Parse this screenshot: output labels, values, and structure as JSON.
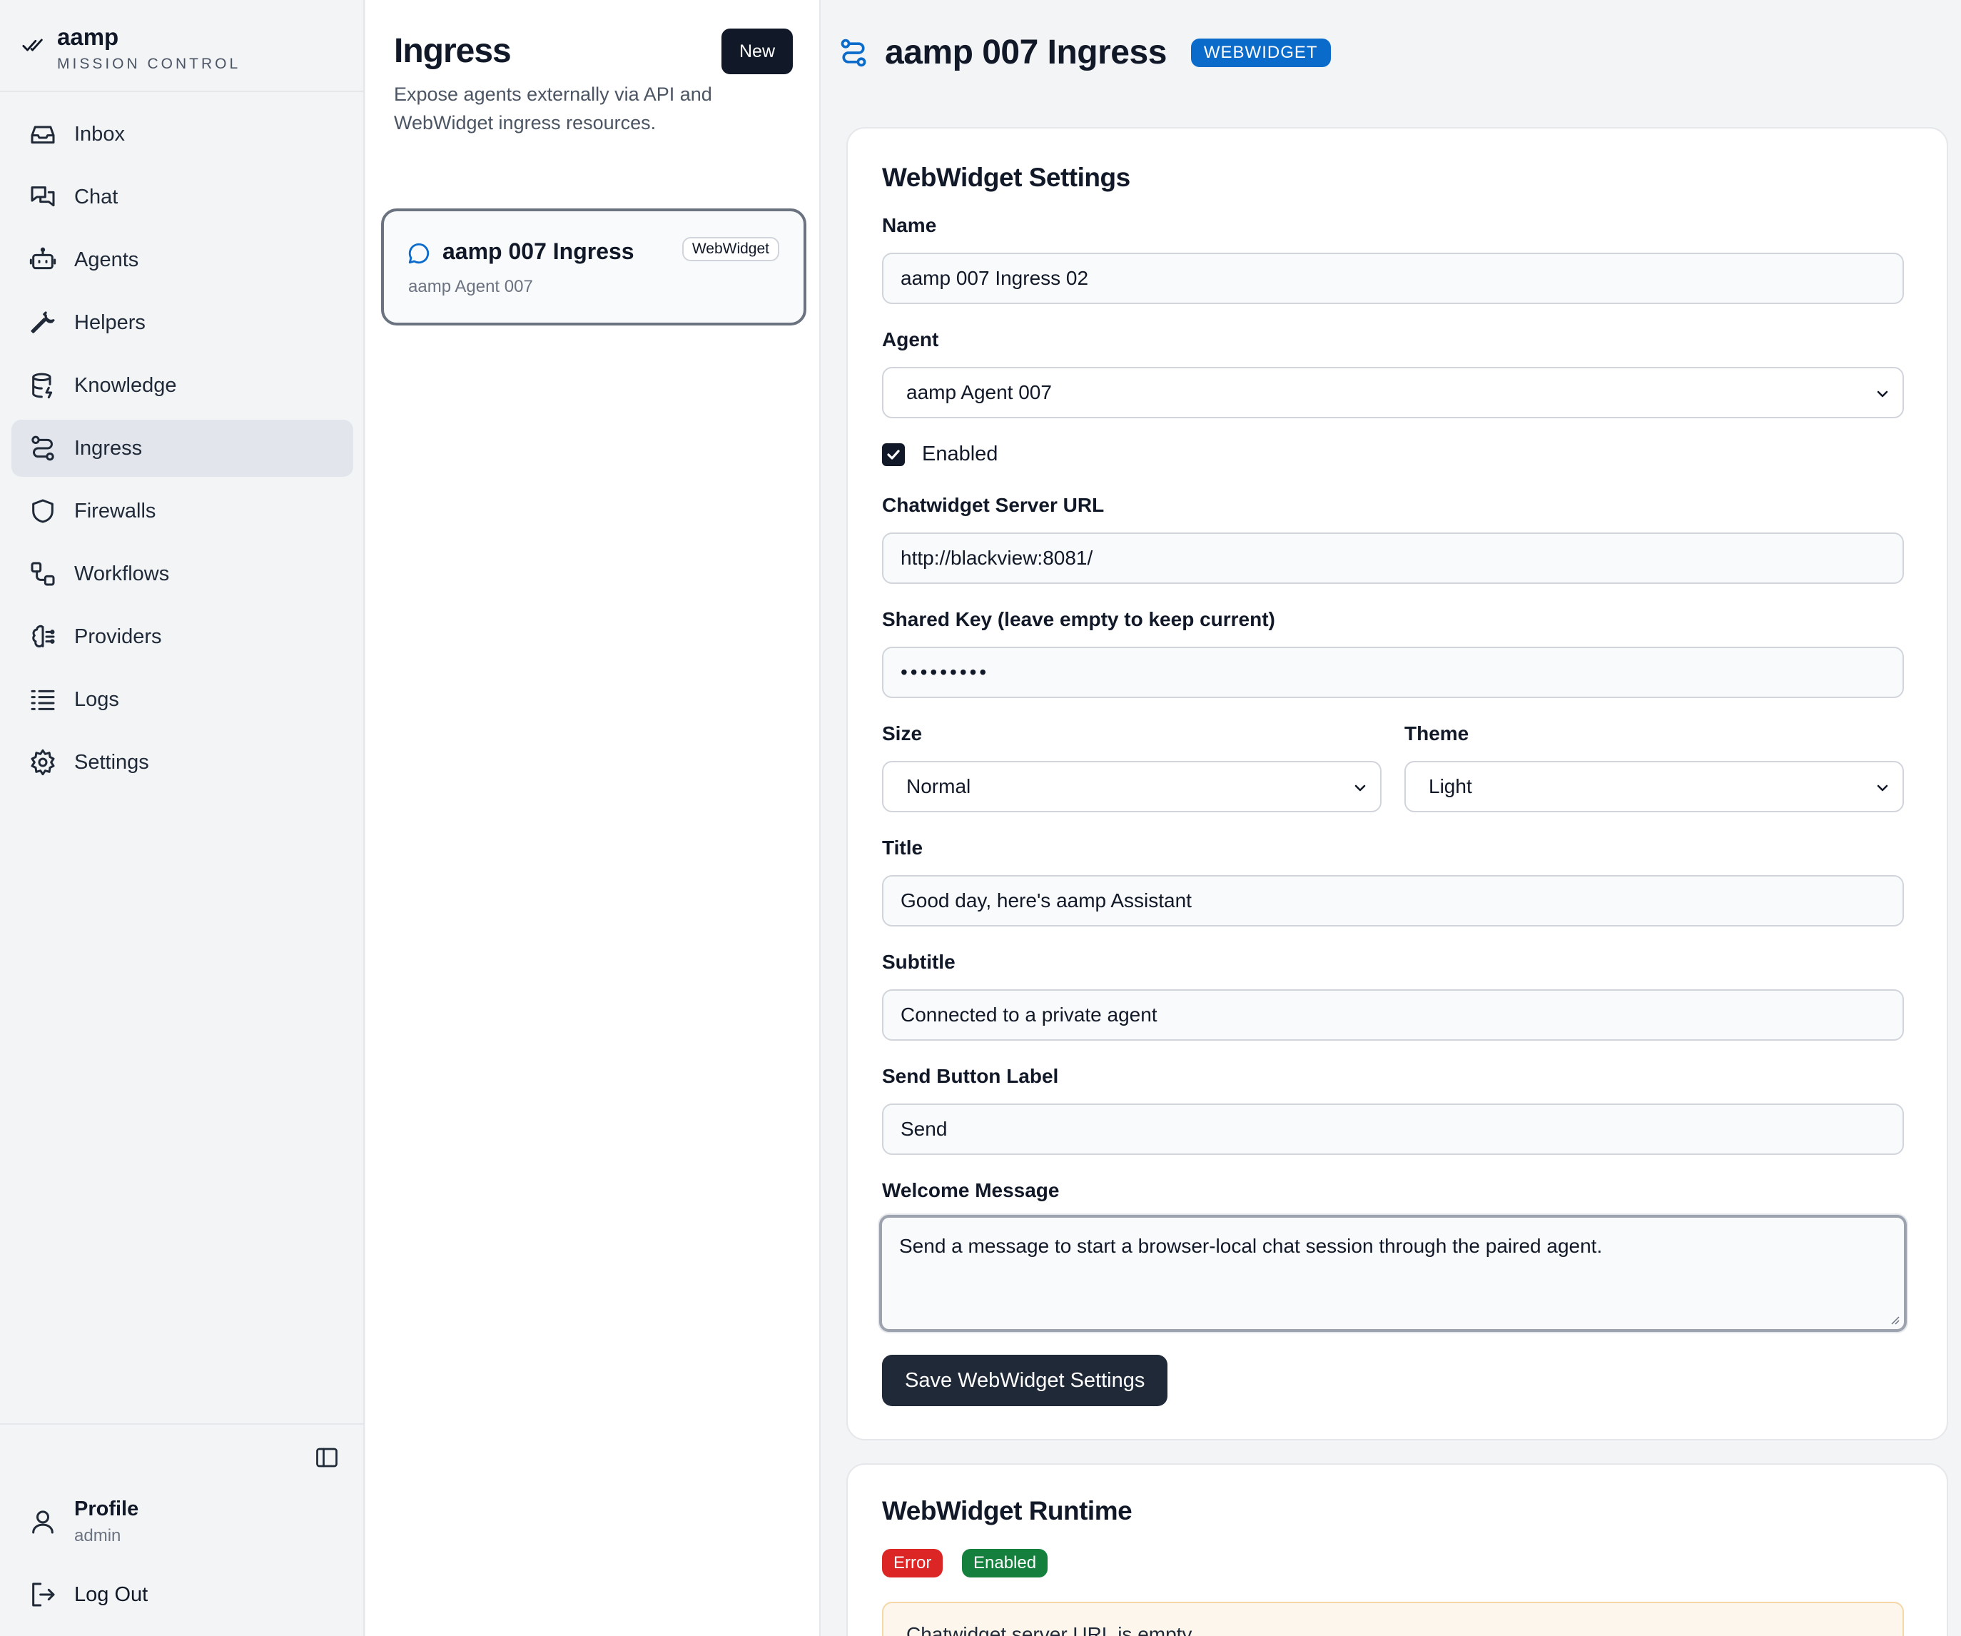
{
  "brand": {
    "name": "aamp",
    "subtitle": "MISSION CONTROL"
  },
  "sidebar": {
    "items": [
      {
        "label": "Inbox",
        "icon": "inbox-icon"
      },
      {
        "label": "Chat",
        "icon": "chat-bubbles-icon"
      },
      {
        "label": "Agents",
        "icon": "robot-icon"
      },
      {
        "label": "Helpers",
        "icon": "wrench-icon"
      },
      {
        "label": "Knowledge",
        "icon": "database-icon"
      },
      {
        "label": "Ingress",
        "icon": "route-icon",
        "active": true
      },
      {
        "label": "Firewalls",
        "icon": "shield-icon"
      },
      {
        "label": "Workflows",
        "icon": "workflow-icon"
      },
      {
        "label": "Providers",
        "icon": "brain-icon"
      },
      {
        "label": "Logs",
        "icon": "list-icon"
      },
      {
        "label": "Settings",
        "icon": "gear-icon"
      }
    ],
    "profile": {
      "name": "Profile",
      "role": "admin"
    },
    "logout_label": "Log Out"
  },
  "list": {
    "title": "Ingress",
    "new_label": "New",
    "description": "Expose agents externally via API and WebWidget ingress resources.",
    "items": [
      {
        "title": "aamp 007 Ingress",
        "badge": "WebWidget",
        "subtitle": "aamp Agent 007"
      }
    ]
  },
  "main": {
    "title": "aamp 007 Ingress",
    "type_badge": "WEBWIDGET",
    "settings": {
      "heading": "WebWidget Settings",
      "name_label": "Name",
      "name_value": "aamp 007 Ingress 02",
      "agent_label": "Agent",
      "agent_value": "aamp Agent 007",
      "enabled_label": "Enabled",
      "enabled": true,
      "server_url_label": "Chatwidget Server URL",
      "server_url_value": "http://blackview:8081/",
      "shared_key_label": "Shared Key (leave empty to keep current)",
      "shared_key_value": "•••••••••",
      "size_label": "Size",
      "size_value": "Normal",
      "theme_label": "Theme",
      "theme_value": "Light",
      "title_label": "Title",
      "title_value": "Good day, here's aamp Assistant",
      "subtitle_label": "Subtitle",
      "subtitle_value": "Connected to a private agent",
      "send_label_label": "Send Button Label",
      "send_label_value": "Send",
      "welcome_label": "Welcome Message",
      "welcome_value": "Send a message to start a browser-local chat session through the paired agent.",
      "save_label": "Save WebWidget Settings"
    },
    "runtime": {
      "heading": "WebWidget Runtime",
      "status_error": "Error",
      "status_enabled": "Enabled",
      "message": "Chatwidget server URL is empty"
    }
  },
  "colors": {
    "accent": "#0b6bcb",
    "dark_button": "#111827",
    "error": "#dc2626",
    "success": "#15803d"
  }
}
